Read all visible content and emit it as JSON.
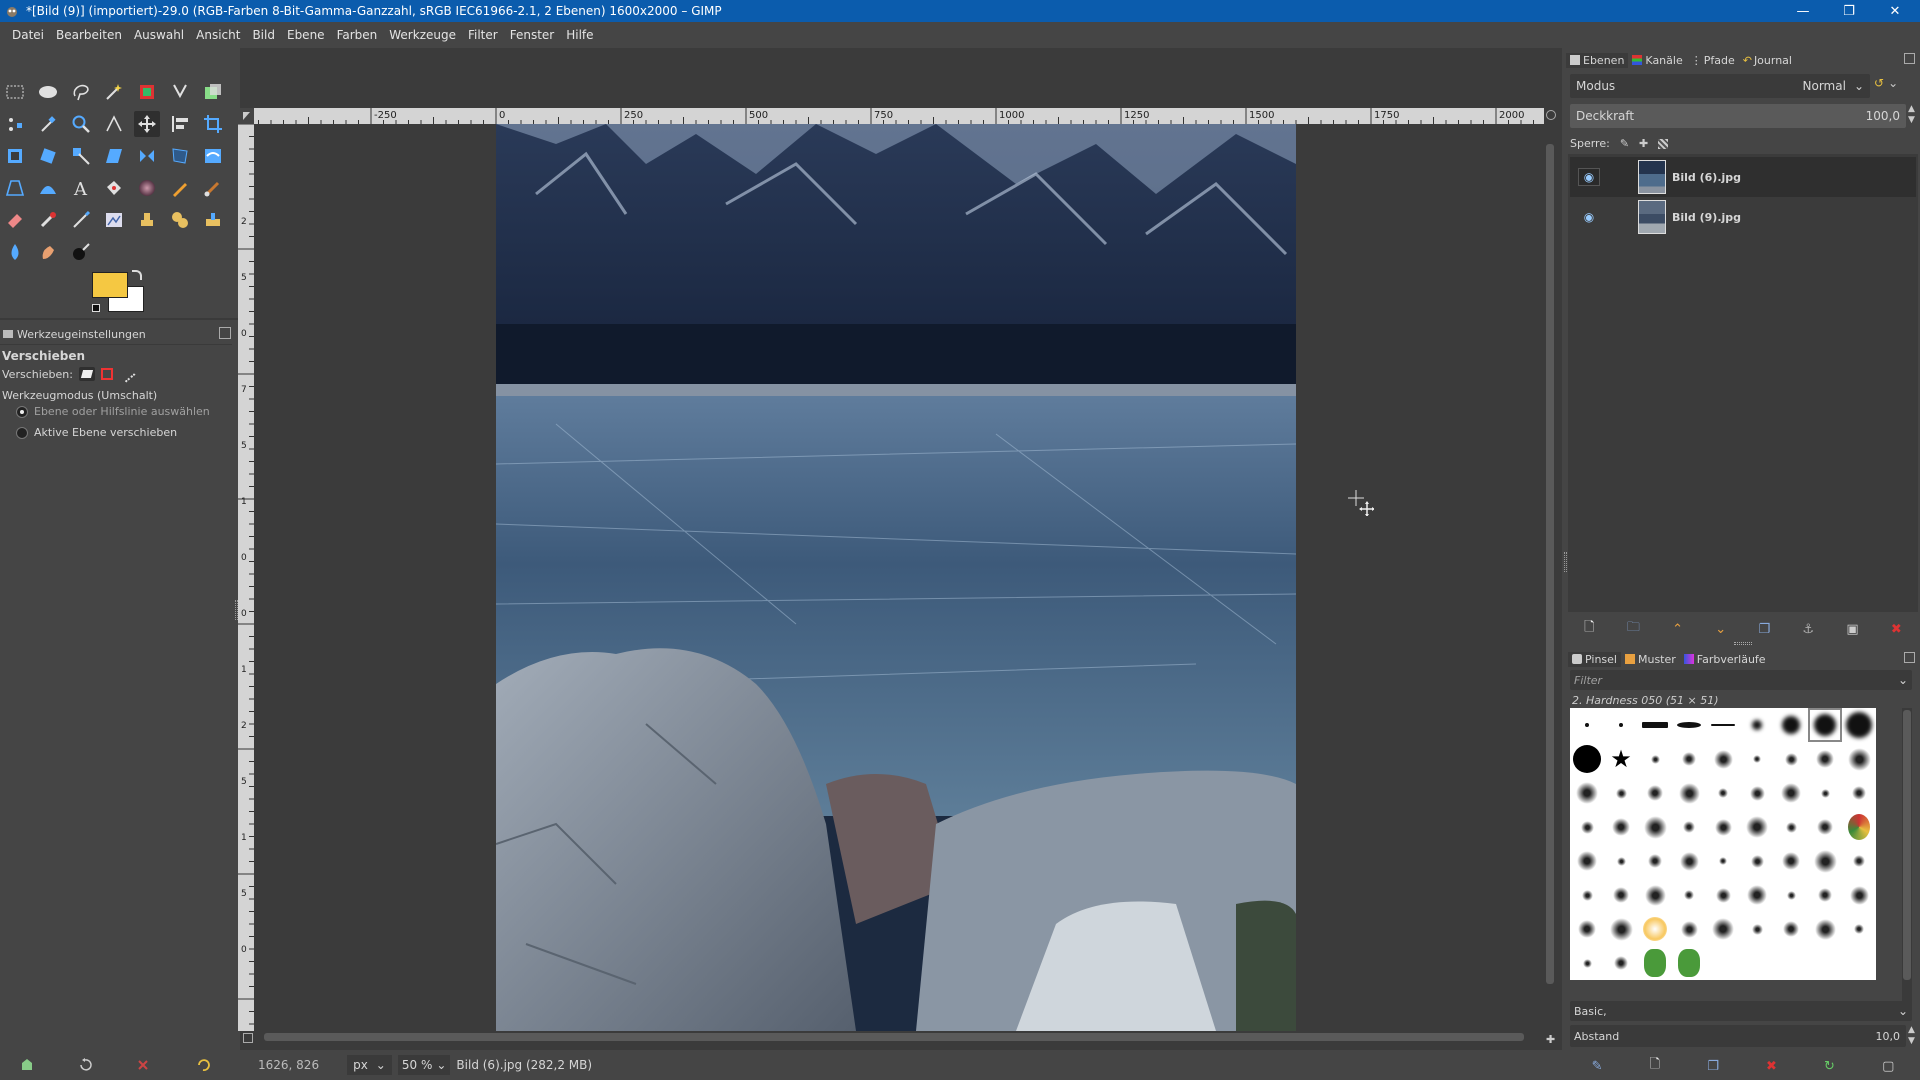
{
  "window": {
    "title": "*[Bild (9)] (importiert)-29.0 (RGB-Farben 8-Bit-Gamma-Ganzzahl, sRGB IEC61966-2.1, 2 Ebenen) 1600x2000 – GIMP",
    "controls": [
      "minimize",
      "restore",
      "close"
    ]
  },
  "menu": [
    "Datei",
    "Bearbeiten",
    "Auswahl",
    "Ansicht",
    "Bild",
    "Ebene",
    "Farben",
    "Werkzeuge",
    "Filter",
    "Fenster",
    "Hilfe"
  ],
  "colors": {
    "foreground": "#f5c842",
    "background": "#ffffff",
    "titlebar": "#0b5cad",
    "panel": "#454545",
    "canvas_bg": "#3b3b3b"
  },
  "tool_options": {
    "tab_label": "Werkzeugeinstellungen",
    "heading": "Verschieben",
    "move_label": "Verschieben:",
    "mode_label": "Werkzeugmodus (Umschalt)",
    "option_1": "Ebene oder Hilfslinie auswählen",
    "option_2": "Aktive Ebene verschieben",
    "selected_option": "Ebene oder Hilfslinie auswählen"
  },
  "ruler": {
    "h_labels": [
      "0",
      "250",
      "500",
      "750",
      "1000",
      "1250",
      "1500",
      "1750",
      "2000"
    ],
    "v_labels": [
      "2",
      "5",
      "0",
      "7",
      "5",
      "1",
      "0",
      "0",
      "1",
      "2",
      "5",
      "1",
      "5",
      "0"
    ]
  },
  "layers_dock": {
    "tabs": [
      "Ebenen",
      "Kanäle",
      "Pfade",
      "Journal"
    ],
    "mode_label": "Modus",
    "mode_value": "Normal",
    "opacity_label": "Deckkraft",
    "opacity_value": "100,0",
    "lock_label": "Sperre:",
    "layers": [
      {
        "name": "Bild (6).jpg",
        "visible": true,
        "selected": true
      },
      {
        "name": "Bild (9).jpg",
        "visible": true,
        "selected": false
      }
    ]
  },
  "brushes_dock": {
    "tabs": [
      "Pinsel",
      "Muster",
      "Farbverläufe"
    ],
    "filter_placeholder": "Filter",
    "selected_brush": "2. Hardness 050 (51 × 51)",
    "preset_value": "Basic,",
    "spacing_label": "Abstand",
    "spacing_value": "10,0"
  },
  "status": {
    "coords": "1626, 826",
    "unit": "px",
    "zoom": "50 %",
    "layer_info": "Bild (6).jpg (282,2 MB)"
  }
}
